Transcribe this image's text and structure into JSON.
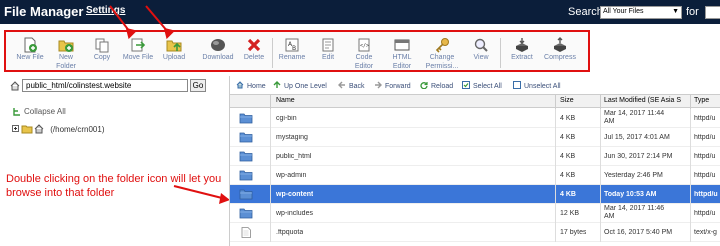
{
  "header": {
    "title": "File Manager",
    "settings": "Settings",
    "search_label": "Search",
    "search_scope": "All Your Files",
    "for_label": "for"
  },
  "toolbar": {
    "buttons": [
      {
        "label_1": "New File",
        "label_2": "",
        "icon": "new-file-icon"
      },
      {
        "label_1": "New",
        "label_2": "Folder",
        "icon": "new-folder-icon"
      },
      {
        "label_1": "Copy",
        "label_2": "",
        "icon": "copy-icon"
      },
      {
        "label_1": "Move File",
        "label_2": "",
        "icon": "move-file-icon"
      },
      {
        "label_1": "Upload",
        "label_2": "",
        "icon": "upload-icon"
      },
      {
        "label_1": "Download",
        "label_2": "",
        "icon": "download-icon"
      },
      {
        "label_1": "Delete",
        "label_2": "",
        "icon": "delete-icon"
      },
      {
        "label_1": "Rename",
        "label_2": "",
        "icon": "rename-icon"
      },
      {
        "label_1": "Edit",
        "label_2": "",
        "icon": "edit-icon"
      },
      {
        "label_1": "Code",
        "label_2": "Editor",
        "icon": "code-editor-icon"
      },
      {
        "label_1": "HTML",
        "label_2": "Editor",
        "icon": "html-editor-icon"
      },
      {
        "label_1": "Change",
        "label_2": "Permissi...",
        "icon": "permissions-icon"
      },
      {
        "label_1": "View",
        "label_2": "",
        "icon": "view-icon"
      },
      {
        "label_1": "Extract",
        "label_2": "",
        "icon": "extract-icon"
      },
      {
        "label_1": "Compress",
        "label_2": "",
        "icon": "compress-icon"
      }
    ]
  },
  "left": {
    "path": "public_html/colinstest.website",
    "go": "Go",
    "collapse_all": "Collapse All",
    "tree_root": "(/home/crn001)"
  },
  "annotation": "Double clicking on the folder icon will let you browse into that folder",
  "nav": {
    "home": "Home",
    "up_one_level": "Up One Level",
    "back": "Back",
    "forward": "Forward",
    "reload": "Reload",
    "select_all": "Select All",
    "unselect_all": "Unselect All"
  },
  "table": {
    "columns": {
      "name": "Name",
      "size": "Size",
      "modified": "Last Modified (SE Asia S",
      "type": "Type"
    },
    "rows": [
      {
        "name": "cgi-bin",
        "size": "4 KB",
        "date_1": "Mar 14, 2017 11:44",
        "date_2": "AM",
        "type": "httpd/u",
        "kind": "folder",
        "selected": false
      },
      {
        "name": "mystaging",
        "size": "4 KB",
        "date_1": "Jul 15, 2017 4:01 AM",
        "date_2": "",
        "type": "httpd/u",
        "kind": "folder",
        "selected": false
      },
      {
        "name": "public_html",
        "size": "4 KB",
        "date_1": "Jun 30, 2017 2:14 PM",
        "date_2": "",
        "type": "httpd/u",
        "kind": "folder",
        "selected": false
      },
      {
        "name": "wp-admin",
        "size": "4 KB",
        "date_1": "Yesterday 2:46 PM",
        "date_2": "",
        "type": "httpd/u",
        "kind": "folder",
        "selected": false
      },
      {
        "name": "wp-content",
        "size": "4 KB",
        "date_1": "Today 10:53 AM",
        "date_2": "",
        "type": "httpd/u",
        "kind": "folder",
        "selected": true
      },
      {
        "name": "wp-includes",
        "size": "12 KB",
        "date_1": "Mar 14, 2017 11:46",
        "date_2": "AM",
        "type": "httpd/u",
        "kind": "folder",
        "selected": false
      },
      {
        "name": ".ftpquota",
        "size": "17 bytes",
        "date_1": "Oct 16, 2017 5:40 PM",
        "date_2": "",
        "type": "text/x-g",
        "kind": "file",
        "selected": false
      }
    ]
  }
}
